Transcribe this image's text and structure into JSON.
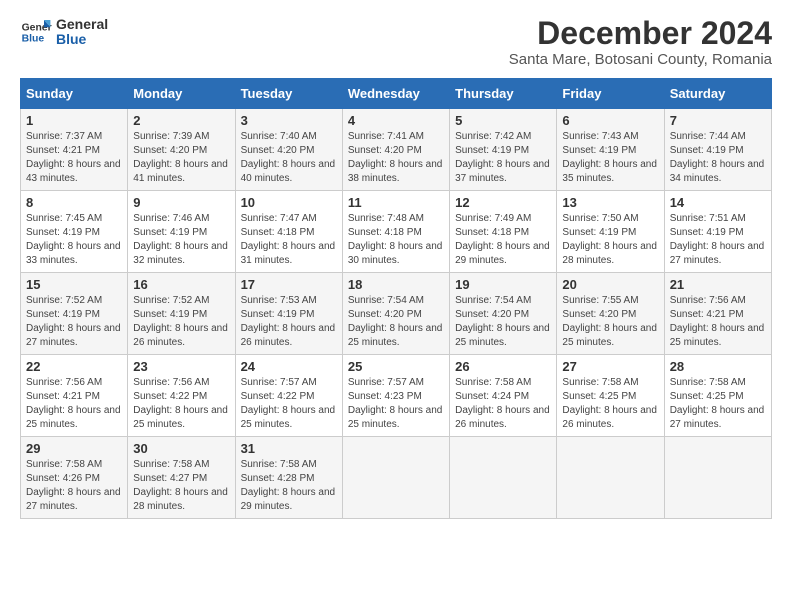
{
  "logo": {
    "line1": "General",
    "line2": "Blue"
  },
  "title": "December 2024",
  "subtitle": "Santa Mare, Botosani County, Romania",
  "days_header": [
    "Sunday",
    "Monday",
    "Tuesday",
    "Wednesday",
    "Thursday",
    "Friday",
    "Saturday"
  ],
  "weeks": [
    [
      {
        "day": "1",
        "sunrise": "7:37 AM",
        "sunset": "4:21 PM",
        "daylight": "8 hours and 43 minutes."
      },
      {
        "day": "2",
        "sunrise": "7:39 AM",
        "sunset": "4:20 PM",
        "daylight": "8 hours and 41 minutes."
      },
      {
        "day": "3",
        "sunrise": "7:40 AM",
        "sunset": "4:20 PM",
        "daylight": "8 hours and 40 minutes."
      },
      {
        "day": "4",
        "sunrise": "7:41 AM",
        "sunset": "4:20 PM",
        "daylight": "8 hours and 38 minutes."
      },
      {
        "day": "5",
        "sunrise": "7:42 AM",
        "sunset": "4:19 PM",
        "daylight": "8 hours and 37 minutes."
      },
      {
        "day": "6",
        "sunrise": "7:43 AM",
        "sunset": "4:19 PM",
        "daylight": "8 hours and 35 minutes."
      },
      {
        "day": "7",
        "sunrise": "7:44 AM",
        "sunset": "4:19 PM",
        "daylight": "8 hours and 34 minutes."
      }
    ],
    [
      {
        "day": "8",
        "sunrise": "7:45 AM",
        "sunset": "4:19 PM",
        "daylight": "8 hours and 33 minutes."
      },
      {
        "day": "9",
        "sunrise": "7:46 AM",
        "sunset": "4:19 PM",
        "daylight": "8 hours and 32 minutes."
      },
      {
        "day": "10",
        "sunrise": "7:47 AM",
        "sunset": "4:18 PM",
        "daylight": "8 hours and 31 minutes."
      },
      {
        "day": "11",
        "sunrise": "7:48 AM",
        "sunset": "4:18 PM",
        "daylight": "8 hours and 30 minutes."
      },
      {
        "day": "12",
        "sunrise": "7:49 AM",
        "sunset": "4:18 PM",
        "daylight": "8 hours and 29 minutes."
      },
      {
        "day": "13",
        "sunrise": "7:50 AM",
        "sunset": "4:19 PM",
        "daylight": "8 hours and 28 minutes."
      },
      {
        "day": "14",
        "sunrise": "7:51 AM",
        "sunset": "4:19 PM",
        "daylight": "8 hours and 27 minutes."
      }
    ],
    [
      {
        "day": "15",
        "sunrise": "7:52 AM",
        "sunset": "4:19 PM",
        "daylight": "8 hours and 27 minutes."
      },
      {
        "day": "16",
        "sunrise": "7:52 AM",
        "sunset": "4:19 PM",
        "daylight": "8 hours and 26 minutes."
      },
      {
        "day": "17",
        "sunrise": "7:53 AM",
        "sunset": "4:19 PM",
        "daylight": "8 hours and 26 minutes."
      },
      {
        "day": "18",
        "sunrise": "7:54 AM",
        "sunset": "4:20 PM",
        "daylight": "8 hours and 25 minutes."
      },
      {
        "day": "19",
        "sunrise": "7:54 AM",
        "sunset": "4:20 PM",
        "daylight": "8 hours and 25 minutes."
      },
      {
        "day": "20",
        "sunrise": "7:55 AM",
        "sunset": "4:20 PM",
        "daylight": "8 hours and 25 minutes."
      },
      {
        "day": "21",
        "sunrise": "7:56 AM",
        "sunset": "4:21 PM",
        "daylight": "8 hours and 25 minutes."
      }
    ],
    [
      {
        "day": "22",
        "sunrise": "7:56 AM",
        "sunset": "4:21 PM",
        "daylight": "8 hours and 25 minutes."
      },
      {
        "day": "23",
        "sunrise": "7:56 AM",
        "sunset": "4:22 PM",
        "daylight": "8 hours and 25 minutes."
      },
      {
        "day": "24",
        "sunrise": "7:57 AM",
        "sunset": "4:22 PM",
        "daylight": "8 hours and 25 minutes."
      },
      {
        "day": "25",
        "sunrise": "7:57 AM",
        "sunset": "4:23 PM",
        "daylight": "8 hours and 25 minutes."
      },
      {
        "day": "26",
        "sunrise": "7:58 AM",
        "sunset": "4:24 PM",
        "daylight": "8 hours and 26 minutes."
      },
      {
        "day": "27",
        "sunrise": "7:58 AM",
        "sunset": "4:25 PM",
        "daylight": "8 hours and 26 minutes."
      },
      {
        "day": "28",
        "sunrise": "7:58 AM",
        "sunset": "4:25 PM",
        "daylight": "8 hours and 27 minutes."
      }
    ],
    [
      {
        "day": "29",
        "sunrise": "7:58 AM",
        "sunset": "4:26 PM",
        "daylight": "8 hours and 27 minutes."
      },
      {
        "day": "30",
        "sunrise": "7:58 AM",
        "sunset": "4:27 PM",
        "daylight": "8 hours and 28 minutes."
      },
      {
        "day": "31",
        "sunrise": "7:58 AM",
        "sunset": "4:28 PM",
        "daylight": "8 hours and 29 minutes."
      },
      null,
      null,
      null,
      null
    ]
  ]
}
